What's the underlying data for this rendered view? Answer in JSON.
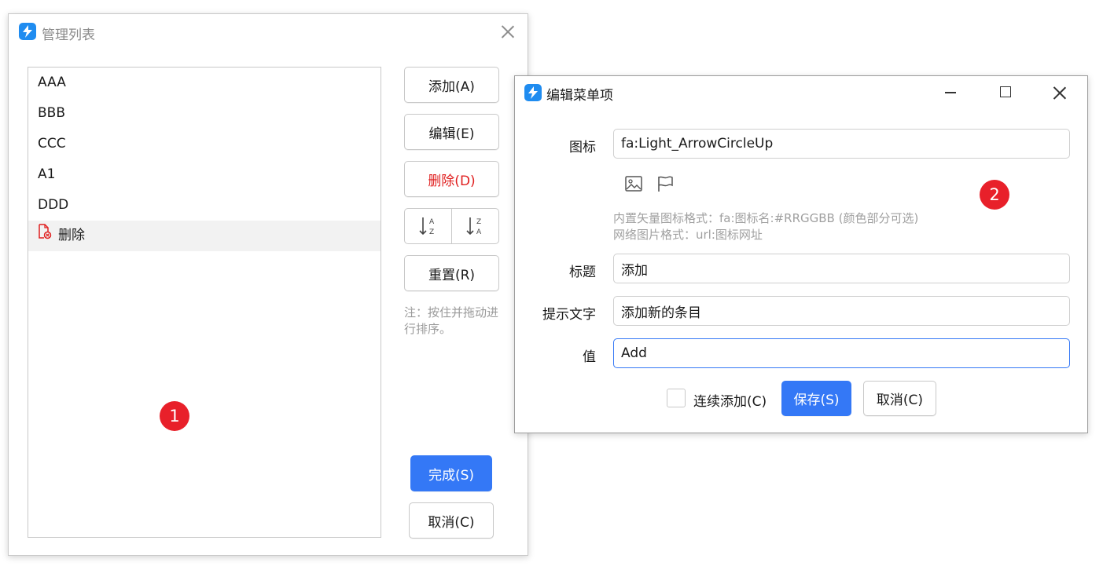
{
  "manage_window": {
    "title": "管理列表",
    "items": [
      "AAA",
      "BBB",
      "CCC",
      "A1",
      "DDD",
      "删除"
    ],
    "buttons": {
      "add": "添加(A)",
      "edit": "编辑(E)",
      "delete": "删除(D)",
      "reset": "重置(R)",
      "done": "完成(S)",
      "cancel": "取消(C)"
    },
    "note": "注：按住并拖动进行排序。",
    "badge": "1"
  },
  "edit_window": {
    "title": "编辑菜单项",
    "labels": {
      "icon": "图标",
      "title": "标题",
      "tooltip": "提示文字",
      "value": "值"
    },
    "values": {
      "icon": "fa:Light_ArrowCircleUp",
      "title": "添加",
      "tooltip": "添加新的条目",
      "value": "Add"
    },
    "hints": [
      "内置矢量图标格式：fa:图标名:#RRGGBB (颜色部分可选)",
      "网络图片格式：url:图标网址"
    ],
    "continuous_add": "连续添加(C)",
    "save": "保存(S)",
    "cancel": "取消(C)",
    "badge": "2"
  },
  "colors": {
    "primary": "#3478f6",
    "danger": "#e02020",
    "badge": "#e8202a",
    "app_icon": "#1f8cf0"
  }
}
